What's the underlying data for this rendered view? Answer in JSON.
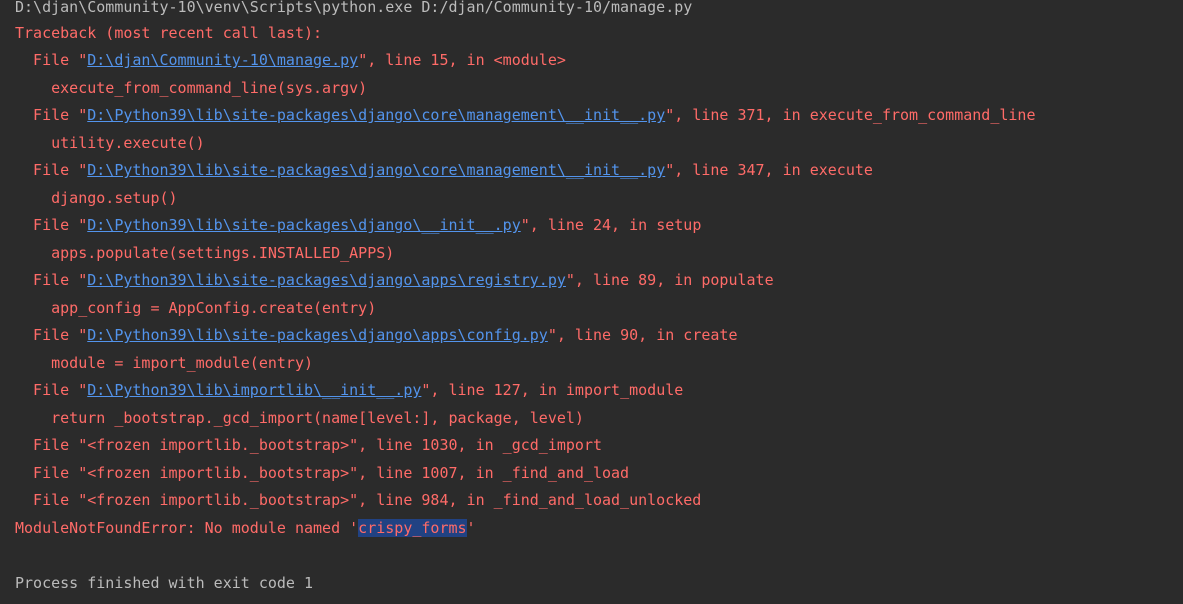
{
  "console": {
    "command_line": "D:\\djan\\Community-10\\venv\\Scripts\\python.exe D:/djan/Community-10/manage.py",
    "traceback_header": "Traceback (most recent call last):",
    "frames": [
      {
        "prefix": "  File \"",
        "path": "D:\\djan\\Community-10\\manage.py",
        "suffix": "\", line 15, in <module>",
        "code": "    execute_from_command_line(sys.argv)"
      },
      {
        "prefix": "  File \"",
        "path": "D:\\Python39\\lib\\site-packages\\django\\core\\management\\__init__.py",
        "suffix": "\", line 371, in execute_from_command_line",
        "code": "    utility.execute()"
      },
      {
        "prefix": "  File \"",
        "path": "D:\\Python39\\lib\\site-packages\\django\\core\\management\\__init__.py",
        "suffix": "\", line 347, in execute",
        "code": "    django.setup()"
      },
      {
        "prefix": "  File \"",
        "path": "D:\\Python39\\lib\\site-packages\\django\\__init__.py",
        "suffix": "\", line 24, in setup",
        "code": "    apps.populate(settings.INSTALLED_APPS)"
      },
      {
        "prefix": "  File \"",
        "path": "D:\\Python39\\lib\\site-packages\\django\\apps\\registry.py",
        "suffix": "\", line 89, in populate",
        "code": "    app_config = AppConfig.create(entry)"
      },
      {
        "prefix": "  File \"",
        "path": "D:\\Python39\\lib\\site-packages\\django\\apps\\config.py",
        "suffix": "\", line 90, in create",
        "code": "    module = import_module(entry)"
      },
      {
        "prefix": "  File \"",
        "path": "D:\\Python39\\lib\\importlib\\__init__.py",
        "suffix": "\", line 127, in import_module",
        "code": "    return _bootstrap._gcd_import(name[level:], package, level)"
      }
    ],
    "frozen_frames": [
      "  File \"<frozen importlib._bootstrap>\", line 1030, in _gcd_import",
      "  File \"<frozen importlib._bootstrap>\", line 1007, in _find_and_load",
      "  File \"<frozen importlib._bootstrap>\", line 984, in _find_and_load_unlocked"
    ],
    "error_prefix": "ModuleNotFoundError: No module named '",
    "error_module": "crispy_forms",
    "error_suffix": "'",
    "exit_message": "Process finished with exit code 1"
  },
  "colors": {
    "background": "#2b2b2b",
    "error_text": "#ff6b68",
    "link": "#5394ec",
    "normal_text": "#bbbbbb",
    "selection": "#214283"
  }
}
